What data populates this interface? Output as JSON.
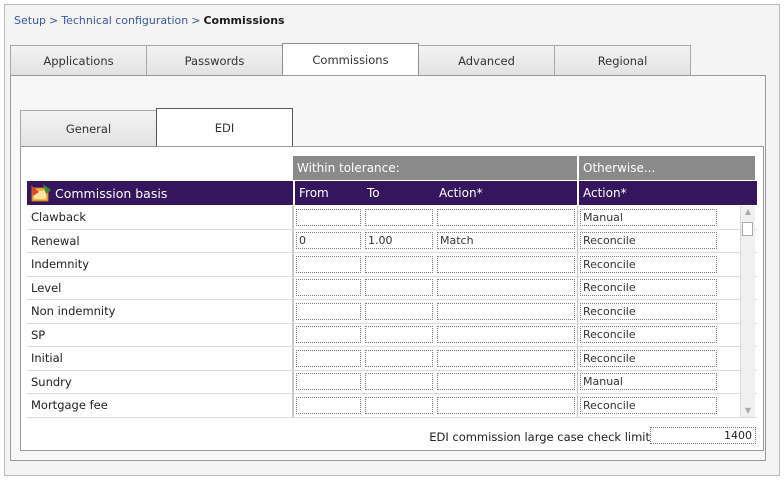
{
  "breadcrumb": {
    "items": [
      "Setup",
      "Technical configuration"
    ],
    "separator": ">",
    "current": "Commissions"
  },
  "main_tabs": [
    "Applications",
    "Passwords",
    "Commissions",
    "Advanced",
    "Regional"
  ],
  "main_tabs_active": "Commissions",
  "sub_tabs": [
    "General",
    "EDI"
  ],
  "sub_tabs_active": "EDI",
  "table": {
    "group_within": "Within tolerance:",
    "group_otherwise": "Otherwise...",
    "col_basis": "Commission basis",
    "col_from": "From",
    "col_to": "To",
    "col_action": "Action*",
    "col_other_action": "Action*",
    "rows": [
      {
        "basis": "Clawback",
        "from": "",
        "to": "",
        "action": "",
        "otherwise": "Manual"
      },
      {
        "basis": "Renewal",
        "from": "0",
        "to": "1.00",
        "action": "Match",
        "otherwise": "Reconcile"
      },
      {
        "basis": "Indemnity",
        "from": "",
        "to": "",
        "action": "",
        "otherwise": "Reconcile"
      },
      {
        "basis": "Level",
        "from": "",
        "to": "",
        "action": "",
        "otherwise": "Reconcile"
      },
      {
        "basis": "Non indemnity",
        "from": "",
        "to": "",
        "action": "",
        "otherwise": "Reconcile"
      },
      {
        "basis": "SP",
        "from": "",
        "to": "",
        "action": "",
        "otherwise": "Reconcile"
      },
      {
        "basis": "Initial",
        "from": "",
        "to": "",
        "action": "",
        "otherwise": "Reconcile"
      },
      {
        "basis": "Sundry",
        "from": "",
        "to": "",
        "action": "",
        "otherwise": "Manual"
      },
      {
        "basis": "Mortgage fee",
        "from": "",
        "to": "",
        "action": "",
        "otherwise": "Reconcile"
      }
    ]
  },
  "limit": {
    "label": "EDI commission large case check limit",
    "value": "1400"
  },
  "colors": {
    "header_bg": "#35155e",
    "group_bg": "#8a8a8a",
    "link": "#3a5a9c"
  },
  "icons": {
    "basis_icon": "commission-basis-icon",
    "scroll_up": "scroll-up-arrow-icon",
    "scroll_down": "scroll-down-arrow-icon"
  }
}
